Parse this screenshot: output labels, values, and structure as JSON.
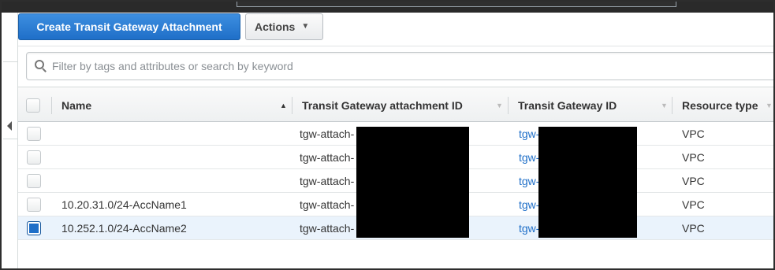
{
  "toolbar": {
    "create_label": "Create Transit Gateway Attachment",
    "actions_label": "Actions",
    "actions_caret": "▼"
  },
  "search": {
    "placeholder": "Filter by tags and attributes or search by keyword",
    "value": ""
  },
  "table": {
    "columns": [
      {
        "label": "Name",
        "sort": "ascending",
        "sort_glyph": "▲"
      },
      {
        "label": "Transit Gateway attachment ID",
        "sort": "none",
        "sort_glyph": "▼"
      },
      {
        "label": "Transit Gateway ID",
        "sort": "none",
        "sort_glyph": "▼"
      },
      {
        "label": "Resource type",
        "sort": "none",
        "sort_glyph": "▼"
      }
    ],
    "rows": [
      {
        "name": "",
        "attachment_id": "tgw-attach-",
        "gateway_id": "tgw-",
        "resource_type": "VPC",
        "selected": false
      },
      {
        "name": "",
        "attachment_id": "tgw-attach-",
        "gateway_id": "tgw-",
        "resource_type": "VPC",
        "selected": false
      },
      {
        "name": "",
        "attachment_id": "tgw-attach-",
        "gateway_id": "tgw-",
        "resource_type": "VPC",
        "selected": false
      },
      {
        "name": "10.20.31.0/24-AccName1",
        "attachment_id": "tgw-attach-",
        "gateway_id": "tgw-",
        "resource_type": "VPC",
        "selected": false
      },
      {
        "name": "10.252.1.0/24-AccName2",
        "attachment_id": "tgw-attach-",
        "gateway_id": "tgw-",
        "resource_type": "VPC",
        "selected": true
      }
    ]
  },
  "colors": {
    "primary": "#1f6fc8",
    "selected_row": "#eaf3fc",
    "redaction": "#000000"
  }
}
